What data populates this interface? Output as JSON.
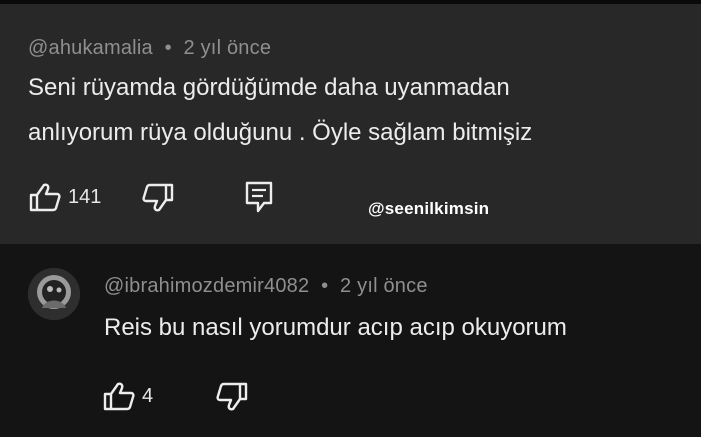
{
  "comments": [
    {
      "handle": "@ahukamalia",
      "separator": "•",
      "time": "2 yıl önce",
      "text_lines": [
        "Seni rüyamda gördüğümde daha uyanmadan",
        "anlıyorum rüya olduğunu . Öyle sağlam bitmişiz"
      ],
      "likes": "141",
      "icons": {
        "like": "thumbs-up-icon",
        "dislike": "thumbs-down-icon",
        "reply": "reply-icon"
      }
    },
    {
      "handle": "@ibrahimozdemir4082",
      "separator": "•",
      "time": "2 yıl önce",
      "text_lines": [
        "Reis bu nasıl yorumdur acıp acıp okuyorum"
      ],
      "likes": "4",
      "icons": {
        "like": "thumbs-up-icon",
        "dislike": "thumbs-down-icon",
        "avatar": "avatar-image"
      }
    }
  ],
  "watermark": "@seenilkimsin",
  "colors": {
    "main_bg": "#282828",
    "reply_bg": "#141414",
    "meta": "#8f8f8f",
    "text": "#ececec"
  }
}
